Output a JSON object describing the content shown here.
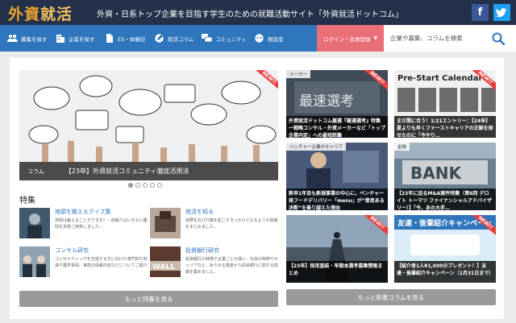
{
  "header": {
    "logo_part1": "外資",
    "logo_part2": "就活",
    "tagline": "外資・日系トップ企業を目指す学生のための就職活動サイト「外資就活ドットコム」",
    "facebook_label": "f",
    "twitter_label": "t"
  },
  "nav": {
    "items": [
      {
        "label": "募集を探す",
        "icon": "people-icon"
      },
      {
        "label": "企業を探す",
        "icon": "building-icon"
      },
      {
        "label": "ES・体験記",
        "icon": "document-icon"
      },
      {
        "label": "就活コラム",
        "icon": "pen-icon"
      },
      {
        "label": "コミュニティ",
        "icon": "chat-icon"
      },
      {
        "label": "相談室",
        "icon": "consult-icon"
      }
    ],
    "login_label": "ログイン・会員登録",
    "search_placeholder": "企業や募集、コラムを検索"
  },
  "slider": {
    "badge": "NEW!!",
    "category": "コラム",
    "title": "【23卒】外資就活コミュニティ徹底活用法"
  },
  "features": {
    "title": "特集",
    "items": [
      {
        "title": "地頭を鍛えるクイズ集",
        "desc": "地頭は鍛えることができる？－前編ではいかない難問を多数ご用意しました。"
      },
      {
        "title": "就活を知る",
        "desc": "就野を広げ行動を起こすきっかけとなるような情報をまとめました。"
      },
      {
        "title": "コンサル研究",
        "desc": "コンサルティングを志望する方に向けた専門的な知識や業界事情、実態の情報内容などについてご紹介"
      },
      {
        "title": "投資銀行研究",
        "desc": "投資銀行の特徴や企業ごとの違い、社員の特徴やキャリアなど、あらゆる角度から投資銀行に関する情報を集めました。"
      }
    ],
    "more_label": "もっと特集を見る"
  },
  "columns": {
    "cards": [
      {
        "tag": "メーカー",
        "badge": "NEW!!",
        "caption": "外資就活ドットコム厳選『厳選選考』特集 ー戦略コンサル・外資メーカーなど「トップ企業内定」への最短距離",
        "image_text": "最速選考"
      },
      {
        "tag": "",
        "badge": "NEW!!",
        "caption": "まだ間に合う！1/21エントリー：【24卒】夏よりも早くファーストキャリアの正解を探せたのに「今やり…",
        "image_text": "Pre-Start Calendar"
      },
      {
        "tag": "ベンチャー企業のキャリア",
        "badge": "",
        "caption": "新卒1年目も新規事業の中心に。ベンチャー発フードデリバリー「menu」が“意思ある決断”を乗り越えた理由",
        "image_text": ""
      },
      {
        "tag": "金融",
        "badge": "",
        "caption": "【23年に迫るM&A案件特集（第6回 デロイト トーマツ ファイナンシャルアドバイザリー）】「今、あの大手…",
        "image_text": "BANK"
      },
      {
        "tag": "",
        "badge": "NEW!!",
        "caption": "【23卒】採用直結・早期本選考募集情報まとめ",
        "image_text": ""
      },
      {
        "tag": "",
        "badge": "NEW!!",
        "caption": "【紹介者1人¥1,000分プレゼント！】友達・後輩紹介キャンペーン（1月31日まで）",
        "image_text": "友達・後輩紹介キャンペーン"
      }
    ],
    "more_label": "もっと新着コラムを見る"
  }
}
